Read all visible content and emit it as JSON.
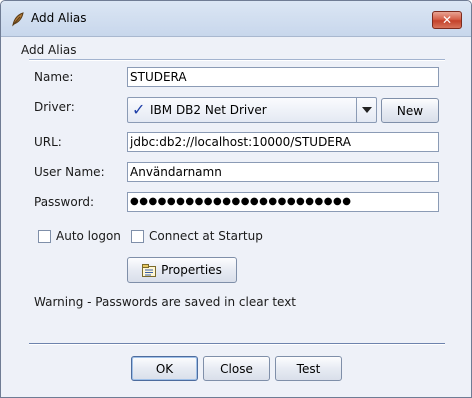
{
  "window": {
    "title": "Add Alias",
    "close_glyph": "✕",
    "app_icon": "feather-icon"
  },
  "form": {
    "section_title": "Add Alias",
    "name": {
      "label": "Name:",
      "value": "STUDERA"
    },
    "driver": {
      "label": "Driver:",
      "value": "IBM DB2 Net Driver",
      "status_icon": "checkmark-icon",
      "new_button": "New"
    },
    "url": {
      "label": "URL:",
      "value": "jdbc:db2://localhost:10000/STUDERA"
    },
    "user_name": {
      "label": "User Name:",
      "value": "Användarnamn"
    },
    "password": {
      "label": "Password:",
      "value": "●●●●●●●●●●●●●●●●●●●●●●●●"
    },
    "auto_logon": {
      "label": "Auto logon",
      "checked": false
    },
    "connect_at_startup": {
      "label": "Connect at Startup",
      "checked": false
    },
    "properties_button": "Properties",
    "warning": "Warning - Passwords are saved in clear text"
  },
  "buttons": {
    "ok": "OK",
    "close": "Close",
    "test": "Test"
  },
  "colors": {
    "window_bg": "#eef1f8",
    "titlebar": "#c8d7ec",
    "close_button": "#c4422b",
    "check_mark": "#1f3fa8",
    "separator": "#6d83ad"
  }
}
